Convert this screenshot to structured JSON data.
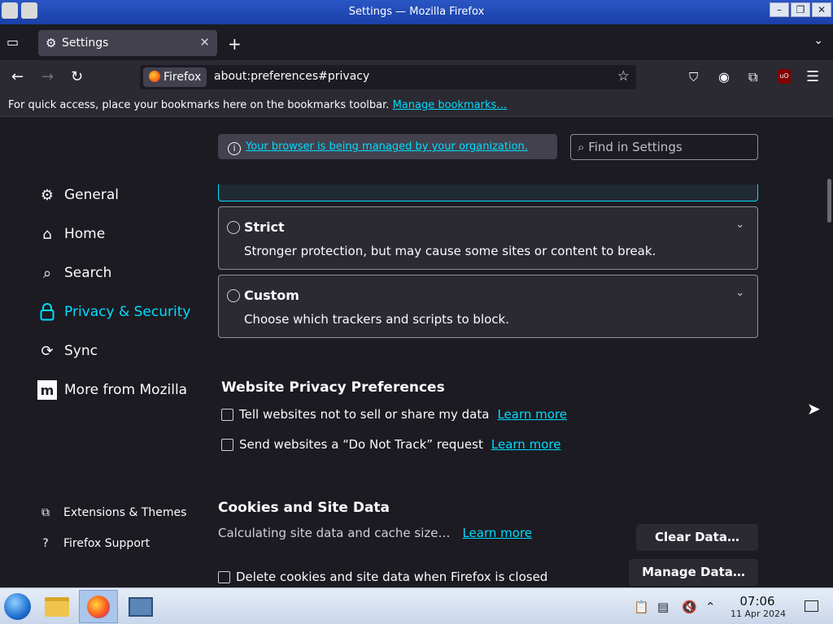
{
  "window": {
    "title": "Settings — Mozilla Firefox"
  },
  "tab": {
    "title": "Settings"
  },
  "urlbar": {
    "identity": "Firefox",
    "url": "about:preferences#privacy"
  },
  "bookmarks_bar": {
    "message": "For quick access, place your bookmarks here on the bookmarks toolbar.",
    "link": "Manage bookmarks…"
  },
  "managed_notice": "Your browser is being managed by your organization.",
  "search": {
    "placeholder": "Find in Settings"
  },
  "sidebar": {
    "items": [
      {
        "label": "General",
        "icon": "gear-icon"
      },
      {
        "label": "Home",
        "icon": "home-icon"
      },
      {
        "label": "Search",
        "icon": "search-icon"
      },
      {
        "label": "Privacy & Security",
        "icon": "lock-icon",
        "active": true
      },
      {
        "label": "Sync",
        "icon": "sync-icon"
      },
      {
        "label": "More from Mozilla",
        "icon": "mozilla-icon"
      }
    ],
    "footer": [
      {
        "label": "Extensions & Themes",
        "icon": "puzzle-icon"
      },
      {
        "label": "Firefox Support",
        "icon": "help-icon"
      }
    ]
  },
  "tracking": {
    "options": [
      {
        "title": "Strict",
        "description": "Stronger protection, but may cause some sites or content to break."
      },
      {
        "title": "Custom",
        "description": "Choose which trackers and scripts to block."
      }
    ]
  },
  "website_privacy": {
    "heading": "Website Privacy Preferences",
    "options": [
      {
        "label": "Tell websites not to sell or share my data",
        "link": "Learn more"
      },
      {
        "label": "Send websites a “Do Not Track” request",
        "link": "Learn more"
      }
    ]
  },
  "cookies": {
    "heading": "Cookies and Site Data",
    "status": "Calculating site data and cache size…",
    "link": "Learn more",
    "clear_button": "Clear Data…",
    "manage_button": "Manage Data…",
    "delete_on_close": "Delete cookies and site data when Firefox is closed"
  },
  "taskbar": {
    "time": "07:06",
    "date": "11 Apr 2024"
  },
  "colors": {
    "accent": "#00ddff",
    "background": "#1c1b22",
    "panel": "#2b2a33"
  }
}
